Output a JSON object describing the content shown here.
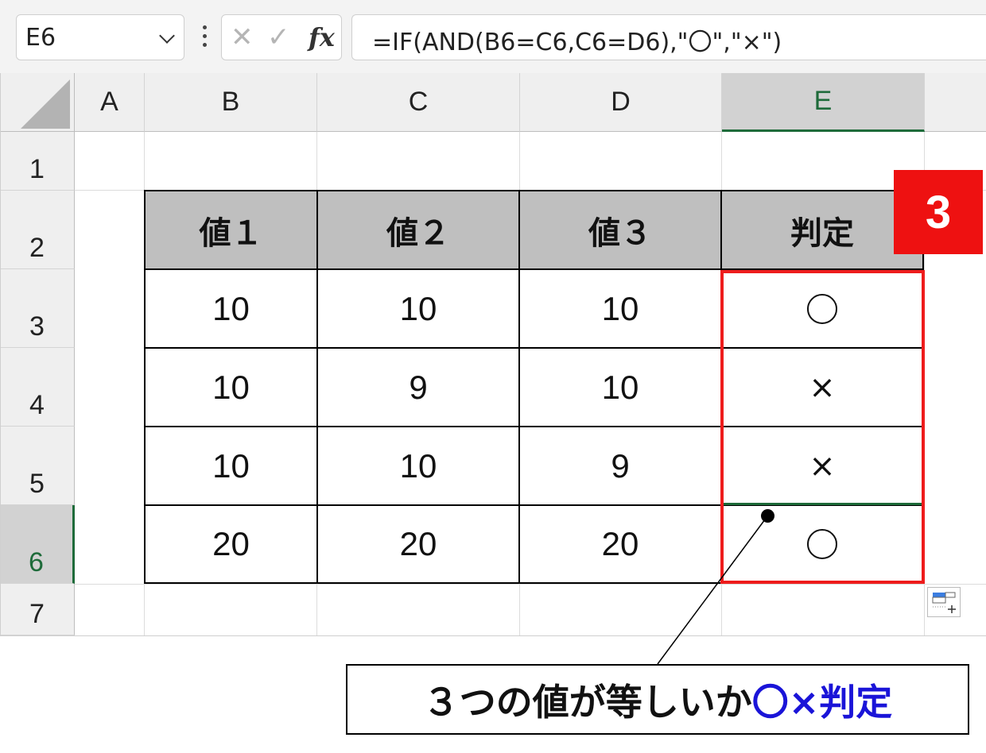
{
  "formula_bar": {
    "name_box": "E6",
    "cancel_icon": "✕",
    "enter_icon": "✓",
    "fx_label": "fx",
    "formula": "=IF(AND(B6=C6,C6=D6),\"〇\",\"×\")"
  },
  "columns": [
    "A",
    "B",
    "C",
    "D",
    "E"
  ],
  "selected_column": "E",
  "rows": [
    "1",
    "2",
    "3",
    "4",
    "5",
    "6",
    "7"
  ],
  "selected_row": "6",
  "table": {
    "headers": [
      "値１",
      "値２",
      "値３",
      "判定"
    ],
    "data": [
      [
        "10",
        "10",
        "10",
        "〇"
      ],
      [
        "10",
        "9",
        "10",
        "×"
      ],
      [
        "10",
        "10",
        "9",
        "×"
      ],
      [
        "20",
        "20",
        "20",
        "〇"
      ]
    ]
  },
  "step_badge": "3",
  "callout": {
    "prefix": "３つの値が等しいか",
    "highlight": "〇×判定"
  },
  "colors": {
    "accent_red": "#ee1111",
    "selection_green": "#1e6b3a",
    "header_gray": "#bfbfbf",
    "callout_blue": "#1a14d8"
  },
  "icons": {
    "quick_analysis": "quick-analysis-icon",
    "select_all": "select-all-corner"
  }
}
